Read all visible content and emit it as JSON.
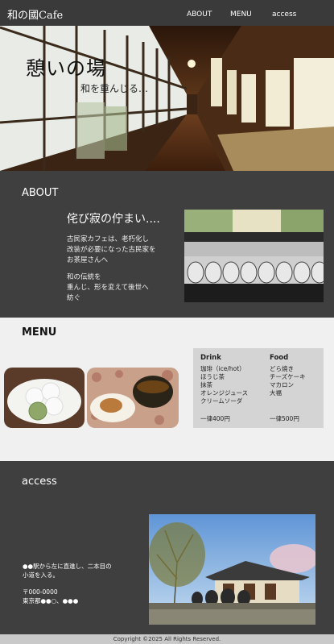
{
  "header": {
    "logo": "和の國Cafe",
    "nav": [
      "ABOUT",
      "MENU",
      "access"
    ]
  },
  "hero": {
    "title": "憩いの場",
    "subtitle": "和を重んじる…"
  },
  "about": {
    "section_title": "ABOUT",
    "heading": "侘び寂の佇まい....",
    "paragraph1": [
      "古民家カフェは、老朽化し",
      "改装が必要になった古民家を",
      "お茶屋さんへ"
    ],
    "paragraph2": [
      "和の伝統を",
      "重んじ、形を変えて後世へ",
      "紡ぐ"
    ]
  },
  "menu": {
    "section_title": "MENU",
    "drink": {
      "heading": "Drink",
      "items": [
        "珈琲（ice/hot）",
        "ほうじ茶",
        "抹茶",
        "オレンジジュース",
        "クリームソーダ"
      ],
      "price": "一律400円"
    },
    "food": {
      "heading": "Food",
      "items": [
        "どら焼き",
        "チーズケーキ",
        "マカロン",
        "大福"
      ],
      "price": "一律500円"
    }
  },
  "access": {
    "section_title": "access",
    "lines1": [
      "●●駅から左に直進し、二本目の",
      "小道を入る。"
    ],
    "lines2": [
      "〒000-0000",
      "東京都●●○、●●●"
    ]
  },
  "footer": {
    "copyright": "Copyright ©2025 All Rights Reserved."
  }
}
